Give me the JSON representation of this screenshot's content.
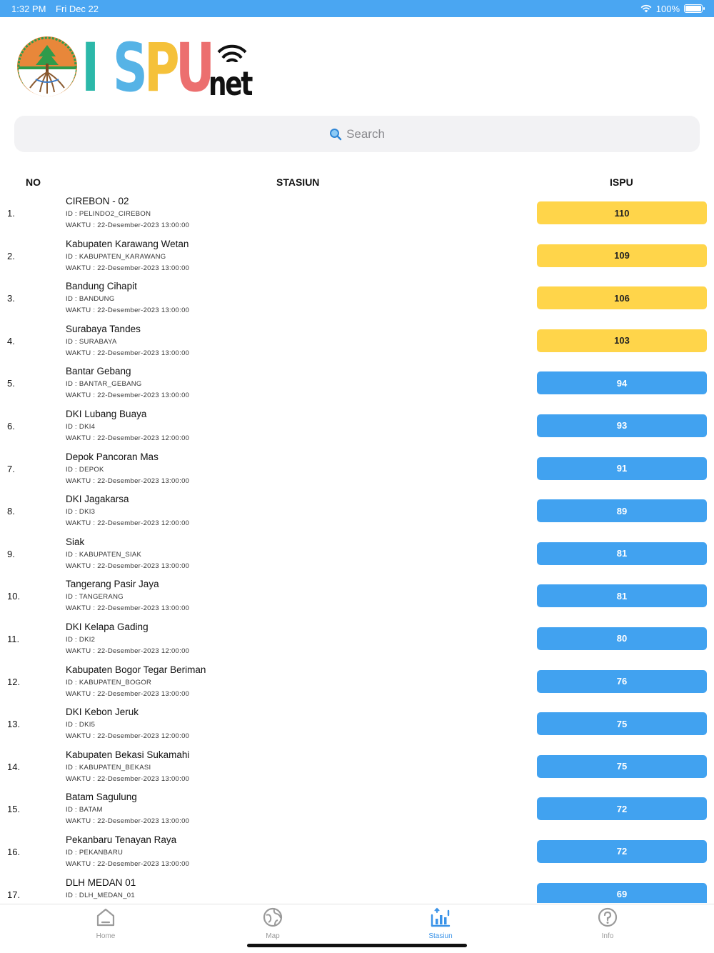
{
  "status_bar": {
    "time": "1:32 PM",
    "date": "Fri Dec 22",
    "battery": "100%"
  },
  "logo": {
    "letters": [
      {
        "char": "I",
        "color": "#2cb8a9"
      },
      {
        "char": "S",
        "color": "#56b3e6"
      },
      {
        "char": "P",
        "color": "#f5c13a"
      },
      {
        "char": "U",
        "color": "#ec6f6f"
      }
    ],
    "suffix": "net",
    "emblem_icon": "tree-emblem-icon",
    "wifi_icon": "wifi-icon"
  },
  "search": {
    "placeholder": "Search",
    "icon": "search-icon"
  },
  "table": {
    "headers": {
      "no": "NO",
      "stasiun": "STASIUN",
      "ispu": "ISPU"
    },
    "rows": [
      {
        "no": "1.",
        "name": "CIREBON - 02",
        "id": "ID : PELINDO2_CIREBON",
        "waktu": "WAKTU : 22-Desember-2023 13:00:00",
        "ispu": "110",
        "status": "yellow"
      },
      {
        "no": "2.",
        "name": "Kabupaten Karawang Wetan",
        "id": "ID : KABUPATEN_KARAWANG",
        "waktu": "WAKTU : 22-Desember-2023 13:00:00",
        "ispu": "109",
        "status": "yellow"
      },
      {
        "no": "3.",
        "name": "Bandung Cihapit",
        "id": "ID : BANDUNG",
        "waktu": "WAKTU : 22-Desember-2023 13:00:00",
        "ispu": "106",
        "status": "yellow"
      },
      {
        "no": "4.",
        "name": "Surabaya Tandes",
        "id": "ID : SURABAYA",
        "waktu": "WAKTU : 22-Desember-2023 13:00:00",
        "ispu": "103",
        "status": "yellow"
      },
      {
        "no": "5.",
        "name": "Bantar Gebang",
        "id": "ID : BANTAR_GEBANG",
        "waktu": "WAKTU : 22-Desember-2023 13:00:00",
        "ispu": "94",
        "status": "blue"
      },
      {
        "no": "6.",
        "name": "DKI Lubang Buaya",
        "id": "ID : DKI4",
        "waktu": "WAKTU : 22-Desember-2023 12:00:00",
        "ispu": "93",
        "status": "blue"
      },
      {
        "no": "7.",
        "name": "Depok Pancoran Mas",
        "id": "ID : DEPOK",
        "waktu": "WAKTU : 22-Desember-2023 13:00:00",
        "ispu": "91",
        "status": "blue"
      },
      {
        "no": "8.",
        "name": "DKI Jagakarsa",
        "id": "ID : DKI3",
        "waktu": "WAKTU : 22-Desember-2023 12:00:00",
        "ispu": "89",
        "status": "blue"
      },
      {
        "no": "9.",
        "name": "Siak",
        "id": "ID : KABUPATEN_SIAK",
        "waktu": "WAKTU : 22-Desember-2023 13:00:00",
        "ispu": "81",
        "status": "blue"
      },
      {
        "no": "10.",
        "name": "Tangerang Pasir Jaya",
        "id": "ID : TANGERANG",
        "waktu": "WAKTU : 22-Desember-2023 13:00:00",
        "ispu": "81",
        "status": "blue"
      },
      {
        "no": "11.",
        "name": "DKI Kelapa Gading",
        "id": "ID : DKI2",
        "waktu": "WAKTU : 22-Desember-2023 12:00:00",
        "ispu": "80",
        "status": "blue"
      },
      {
        "no": "12.",
        "name": "Kabupaten Bogor Tegar Beriman",
        "id": "ID : KABUPATEN_BOGOR",
        "waktu": "WAKTU : 22-Desember-2023 13:00:00",
        "ispu": "76",
        "status": "blue"
      },
      {
        "no": "13.",
        "name": "DKI Kebon Jeruk",
        "id": "ID : DKI5",
        "waktu": "WAKTU : 22-Desember-2023 12:00:00",
        "ispu": "75",
        "status": "blue"
      },
      {
        "no": "14.",
        "name": "Kabupaten Bekasi Sukamahi",
        "id": "ID : KABUPATEN_BEKASI",
        "waktu": "WAKTU : 22-Desember-2023 13:00:00",
        "ispu": "75",
        "status": "blue"
      },
      {
        "no": "15.",
        "name": "Batam Sagulung",
        "id": "ID : BATAM",
        "waktu": "WAKTU : 22-Desember-2023 13:00:00",
        "ispu": "72",
        "status": "blue"
      },
      {
        "no": "16.",
        "name": "Pekanbaru Tenayan Raya",
        "id": "ID : PEKANBARU",
        "waktu": "WAKTU : 22-Desember-2023 13:00:00",
        "ispu": "72",
        "status": "blue"
      },
      {
        "no": "17.",
        "name": "DLH MEDAN 01",
        "id": "ID : DLH_MEDAN_01",
        "waktu": "",
        "ispu": "69",
        "status": "blue"
      }
    ]
  },
  "tabbar": {
    "tabs": [
      {
        "label": "Home",
        "icon": "home-icon",
        "active": false
      },
      {
        "label": "Map",
        "icon": "map-icon",
        "active": false
      },
      {
        "label": "Stasiun",
        "icon": "stasiun-chart-icon",
        "active": true
      },
      {
        "label": "Info",
        "icon": "info-icon",
        "active": false
      }
    ]
  },
  "colors": {
    "status_bar": "#4aa6f2",
    "badge_yellow": "#ffd54a",
    "badge_blue": "#41a2f0",
    "tab_active": "#3a93e8"
  }
}
